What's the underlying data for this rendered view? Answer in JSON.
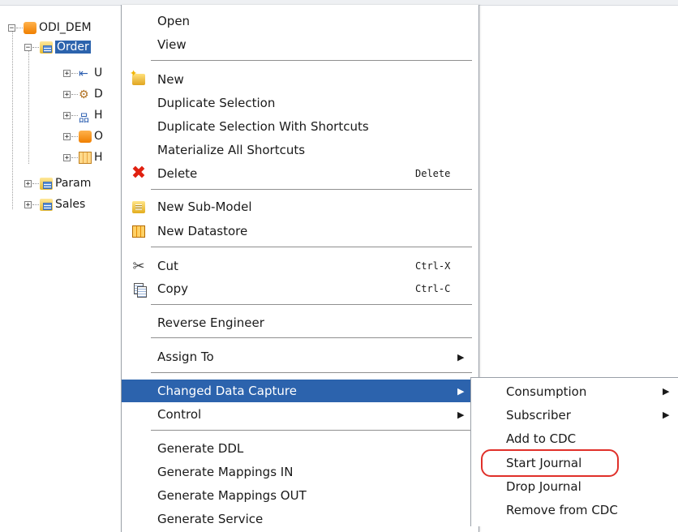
{
  "tree": {
    "root_label": "ODI_DEM",
    "selected_label": "Order",
    "children": [
      {
        "label": "U",
        "icon": "datastore-key-icon"
      },
      {
        "label": "D",
        "icon": "diagram-icon"
      },
      {
        "label": "H",
        "icon": "hierarchy-icon"
      },
      {
        "label": "O",
        "icon": "object-icon"
      },
      {
        "label": "H",
        "icon": "table-icon"
      }
    ],
    "siblings": [
      "Param",
      "Sales"
    ]
  },
  "menu": {
    "open": "Open",
    "view": "View",
    "new": "New",
    "duplicate_selection": "Duplicate Selection",
    "duplicate_with_shortcuts": "Duplicate Selection With Shortcuts",
    "materialize_shortcuts": "Materialize All Shortcuts",
    "delete": "Delete",
    "delete_shortcut": "Delete",
    "new_sub_model": "New Sub-Model",
    "new_datastore": "New Datastore",
    "cut": "Cut",
    "cut_shortcut": "Ctrl-X",
    "copy": "Copy",
    "copy_shortcut": "Ctrl-C",
    "reverse_engineer": "Reverse Engineer",
    "assign_to": "Assign To",
    "changed_data_capture": "Changed Data Capture",
    "control": "Control",
    "generate_ddl": "Generate DDL",
    "generate_mappings_in": "Generate Mappings IN",
    "generate_mappings_out": "Generate Mappings OUT",
    "generate_service": "Generate Service"
  },
  "submenu": {
    "consumption": "Consumption",
    "subscriber": "Subscriber",
    "add_to_cdc": "Add to CDC",
    "start_journal": "Start Journal",
    "drop_journal": "Drop Journal",
    "remove_from_cdc": "Remove from CDC"
  },
  "colors": {
    "selection": "#2c63ad",
    "highlight_ring": "#e0302a"
  }
}
